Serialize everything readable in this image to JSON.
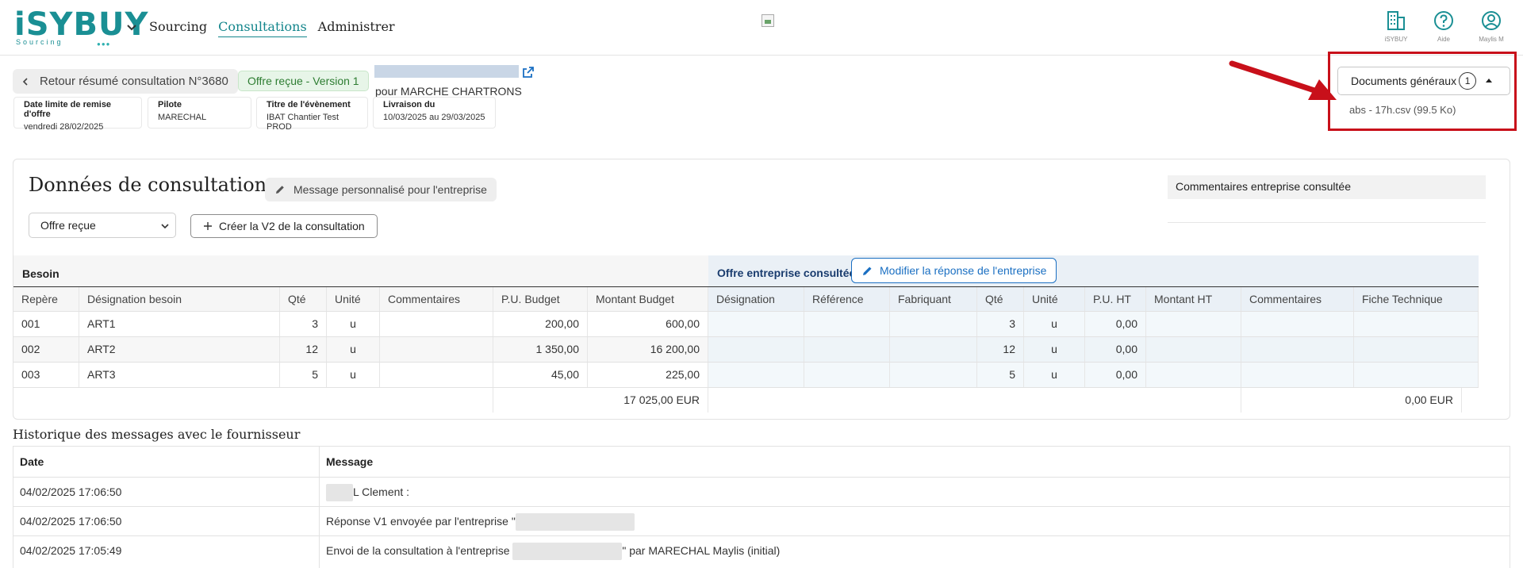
{
  "app": {
    "logo": "iSYBUY",
    "logo_sub": "Sourcing",
    "logo_dots": "●●●"
  },
  "nav": {
    "items": [
      "Sourcing",
      "Consultations",
      "Administrer"
    ],
    "active": "Consultations"
  },
  "top_icons": [
    {
      "name": "building-icon",
      "label": "iSYBUY"
    },
    {
      "name": "help-icon",
      "label": "Aide"
    },
    {
      "name": "user-icon",
      "label": "Maylis M"
    }
  ],
  "header": {
    "back_label": "Retour résumé consultation N°3680",
    "version_badge": "Offre reçue - Version 1",
    "for_text": "pour MARCHE CHARTRONS",
    "cards": [
      {
        "title": "Date limite de remise d'offre",
        "value": "vendredi 28/02/2025"
      },
      {
        "title": "Pilote",
        "value": "MARECHAL"
      },
      {
        "title": "Titre de l'évènement",
        "value": "IBAT Chantier Test PROD"
      },
      {
        "title": "Livraison du",
        "value": "10/03/2025 au 29/03/2025"
      }
    ]
  },
  "documents": {
    "label": "Documents généraux",
    "count": "1",
    "files": [
      "abs - 17h.csv (99.5 Ko)"
    ]
  },
  "panel": {
    "title": "Données de consultation",
    "message_button": "Message personnalisé pour l'entreprise",
    "comment_label": "Commentaires entreprise consultée",
    "select_value": "Offre reçue",
    "create_button": "Créer la V2 de la consultation"
  },
  "table": {
    "besoin_group": "Besoin",
    "offre_group": "Offre entreprise consultée",
    "modify_button": "Modifier la réponse de l'entreprise",
    "columns": [
      "Repère",
      "Désignation besoin",
      "Qté",
      "Unité",
      "Commentaires",
      "P.U. Budget",
      "Montant Budget",
      "Désignation",
      "Référence",
      "Fabriquant",
      "Qté",
      "Unité",
      "P.U. HT",
      "Montant HT",
      "Commentaires",
      "Fiche Technique"
    ],
    "rows": [
      [
        "001",
        "ART1",
        "3",
        "u",
        "",
        "200,00",
        "600,00",
        "",
        "",
        "",
        "3",
        "u",
        "0,00",
        "",
        "",
        ""
      ],
      [
        "002",
        "ART2",
        "12",
        "u",
        "",
        "1 350,00",
        "16 200,00",
        "",
        "",
        "",
        "12",
        "u",
        "0,00",
        "",
        "",
        ""
      ],
      [
        "003",
        "ART3",
        "5",
        "u",
        "",
        "45,00",
        "225,00",
        "",
        "",
        "",
        "5",
        "u",
        "0,00",
        "",
        "",
        ""
      ]
    ],
    "total_budget": "17 025,00 EUR",
    "total_ht": "0,00 EUR"
  },
  "history": {
    "title": "Historique des messages avec le fournisseur",
    "col_date": "Date",
    "col_message": "Message",
    "rows": [
      {
        "date": "04/02/2025 17:06:50",
        "message": "L Clement :"
      },
      {
        "date": "04/02/2025 17:06:50",
        "message": "Réponse V1 envoyée par l'entreprise \""
      },
      {
        "date": "04/02/2025 17:05:49",
        "message_a": "Envoi de la consultation à l'entreprise",
        "message_b": "\" par MARECHAL Maylis (initial)"
      }
    ]
  }
}
